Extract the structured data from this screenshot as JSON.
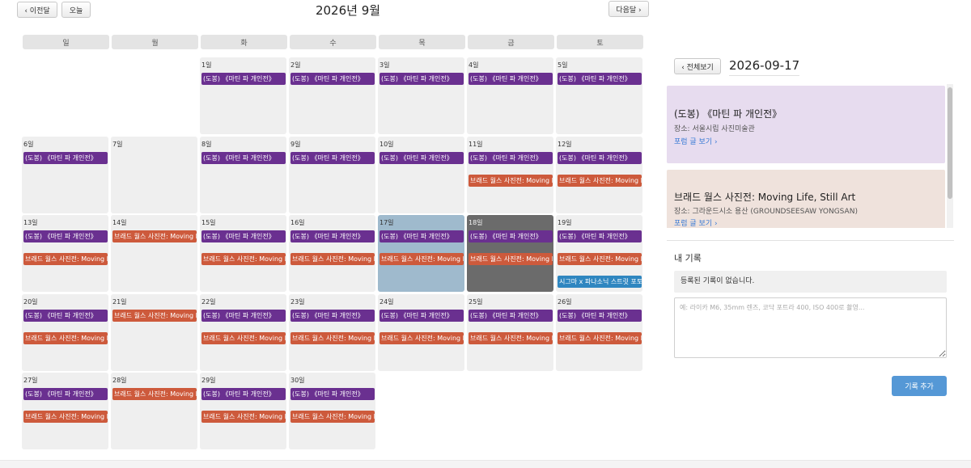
{
  "nav": {
    "prev_label": "‹ 이전달",
    "today_label": "오늘",
    "next_label": "다음달 ›",
    "month_title": "2026년 9월"
  },
  "weekdays": [
    "일",
    "월",
    "화",
    "수",
    "목",
    "금",
    "토"
  ],
  "events": {
    "dobong": "(도봉) 《마틴 파 개인전》",
    "brad": "브래드 월스 사진전: Moving Life, Still Art",
    "sigma": "시그마 x 파나소닉 스트릿 포토"
  },
  "colors": {
    "dobong": "#6a3090",
    "brad": "#cd5a3c",
    "sigma": "#2f86c0",
    "today_cell": "#9fbacd",
    "selected_cell": "#6b6b6b",
    "card_dobong": "#e7dcef",
    "card_brad": "#efe2dc"
  },
  "calendar": {
    "weeks": [
      [
        {
          "day": ""
        },
        {
          "day": ""
        },
        {
          "day": "1일",
          "events": [
            "dobong"
          ]
        },
        {
          "day": "2일",
          "events": [
            "dobong"
          ]
        },
        {
          "day": "3일",
          "events": [
            "dobong"
          ]
        },
        {
          "day": "4일",
          "events": [
            "dobong"
          ]
        },
        {
          "day": "5일",
          "events": [
            "dobong"
          ]
        }
      ],
      [
        {
          "day": "6일",
          "events": [
            "dobong"
          ]
        },
        {
          "day": "7일",
          "events": []
        },
        {
          "day": "8일",
          "events": [
            "dobong"
          ]
        },
        {
          "day": "9일",
          "events": [
            "dobong"
          ]
        },
        {
          "day": "10일",
          "events": [
            "dobong"
          ]
        },
        {
          "day": "11일",
          "events": [
            "dobong",
            "brad"
          ]
        },
        {
          "day": "12일",
          "events": [
            "dobong",
            "brad"
          ]
        }
      ],
      [
        {
          "day": "13일",
          "events": [
            "dobong",
            "brad"
          ]
        },
        {
          "day": "14일",
          "events": [
            "brad"
          ]
        },
        {
          "day": "15일",
          "events": [
            "dobong",
            "brad"
          ]
        },
        {
          "day": "16일",
          "events": [
            "dobong",
            "brad"
          ]
        },
        {
          "day": "17일",
          "events": [
            "dobong",
            "brad"
          ],
          "state": "today"
        },
        {
          "day": "18일",
          "events": [
            "dobong",
            "brad"
          ],
          "state": "selected"
        },
        {
          "day": "19일",
          "events": [
            "dobong",
            "brad",
            "sigma"
          ]
        }
      ],
      [
        {
          "day": "20일",
          "events": [
            "dobong",
            "brad"
          ]
        },
        {
          "day": "21일",
          "events": [
            "brad"
          ]
        },
        {
          "day": "22일",
          "events": [
            "dobong",
            "brad"
          ]
        },
        {
          "day": "23일",
          "events": [
            "dobong",
            "brad"
          ]
        },
        {
          "day": "24일",
          "events": [
            "dobong",
            "brad"
          ]
        },
        {
          "day": "25일",
          "events": [
            "dobong",
            "brad"
          ]
        },
        {
          "day": "26일",
          "events": [
            "dobong",
            "brad"
          ]
        }
      ],
      [
        {
          "day": "27일",
          "events": [
            "dobong",
            "brad"
          ]
        },
        {
          "day": "28일",
          "events": [
            "brad"
          ]
        },
        {
          "day": "29일",
          "events": [
            "dobong",
            "brad"
          ]
        },
        {
          "day": "30일",
          "events": [
            "dobong",
            "brad"
          ]
        }
      ]
    ]
  },
  "detail": {
    "back_label": "‹ 전체보기",
    "date": "2026-09-17",
    "cards": [
      {
        "title": "(도봉) 《마틴 파 개인전》",
        "place": "장소: 서울시립 사진미술관",
        "link": "포럼 글 보기 ›",
        "color_key": "card_dobong"
      },
      {
        "title": "브래드 월스 사진전: Moving Life, Still Art",
        "place": "장소: 그라운드시소 용산 (GROUNDSEESAW YONGSAN)",
        "link": "포럼 글 보기 ›",
        "color_key": "card_brad"
      }
    ]
  },
  "mylog": {
    "title": "내 기록",
    "empty_text": "등록된 기록이 없습니다.",
    "placeholder": "예: 라이카 M6, 35mm 렌즈, 코닥 포트라 400, ISO 400로 촬영...",
    "add_label": "기록 추가"
  }
}
